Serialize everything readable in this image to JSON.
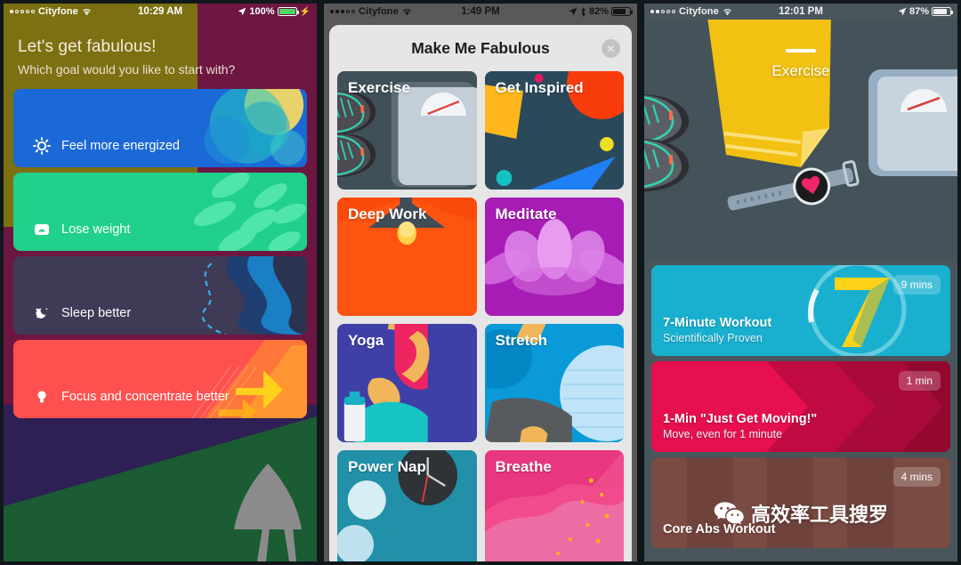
{
  "panels": [
    {
      "id": "goal-picker",
      "status": {
        "carrier": "Cityfone",
        "signal_filled": 1,
        "signal_total": 5,
        "wifi": true,
        "bluetooth": false,
        "time": "10:29 AM",
        "location_icon": true,
        "battery_pct": "100%",
        "charging": true,
        "battery_color": "#4cd964"
      },
      "title": "Let's get fabulous!",
      "subtitle": "Which goal would you like to start with?",
      "goals": [
        {
          "label": "Feel more energized",
          "icon": "sun-icon",
          "color": "#1b69d6"
        },
        {
          "label": "Lose weight",
          "icon": "scale-icon",
          "color": "#21d08a"
        },
        {
          "label": "Sleep better",
          "icon": "moon-icon",
          "color": "#3f3a55"
        },
        {
          "label": "Focus and concentrate better",
          "icon": "bulb-icon",
          "color": "#ff5050"
        }
      ]
    },
    {
      "id": "activity-picker",
      "status": {
        "carrier": "Cityfone",
        "signal_filled": 3,
        "signal_total": 5,
        "wifi": true,
        "bluetooth": true,
        "time": "1:49 PM",
        "location_icon": true,
        "battery_pct": "82%",
        "charging": false,
        "battery_color": "#1f1f1f"
      },
      "modal_title": "Make Me Fabulous",
      "close_label": "✕",
      "tiles": [
        {
          "label": "Exercise",
          "art": "exercise",
          "color": "#3f5058"
        },
        {
          "label": "Get Inspired",
          "art": "inspired",
          "color": "#2a4a5c"
        },
        {
          "label": "Deep Work",
          "art": "deepwork",
          "color": "#fb4b0c"
        },
        {
          "label": "Meditate",
          "art": "meditate",
          "color": "#a61cb5"
        },
        {
          "label": "Yoga",
          "art": "yoga",
          "color": "#3f3fa8"
        },
        {
          "label": "Stretch",
          "art": "stretch",
          "color": "#0a9ad8"
        },
        {
          "label": "Power Nap",
          "art": "powernap",
          "color": "#2190a8"
        },
        {
          "label": "Breathe",
          "art": "breathe",
          "color": "#e8367f"
        }
      ]
    },
    {
      "id": "exercise-list",
      "status": {
        "carrier": "Cityfone",
        "signal_filled": 2,
        "signal_total": 5,
        "wifi": true,
        "bluetooth": false,
        "time": "12:01 PM",
        "location_icon": true,
        "battery_pct": "87%",
        "charging": false,
        "battery_color": "#1f1f1f"
      },
      "hero_title": "Exercise",
      "workouts": [
        {
          "title": "7-Minute Workout",
          "subtitle": "Scientifically Proven",
          "badge": "9 mins",
          "color": "#19b0cf",
          "art": "seven"
        },
        {
          "title": "1-Min \"Just Get Moving!\"",
          "subtitle": "Move, even for 1 minute",
          "badge": "1 min",
          "color": "#e6104e",
          "art": "chevrons"
        },
        {
          "title": "Core Abs Workout",
          "subtitle": "",
          "badge": "4 mins",
          "color": "#7a4b42",
          "art": "abs"
        }
      ]
    }
  ],
  "watermark": {
    "text": "高效率工具搜罗",
    "icon": "wechat-icon"
  }
}
